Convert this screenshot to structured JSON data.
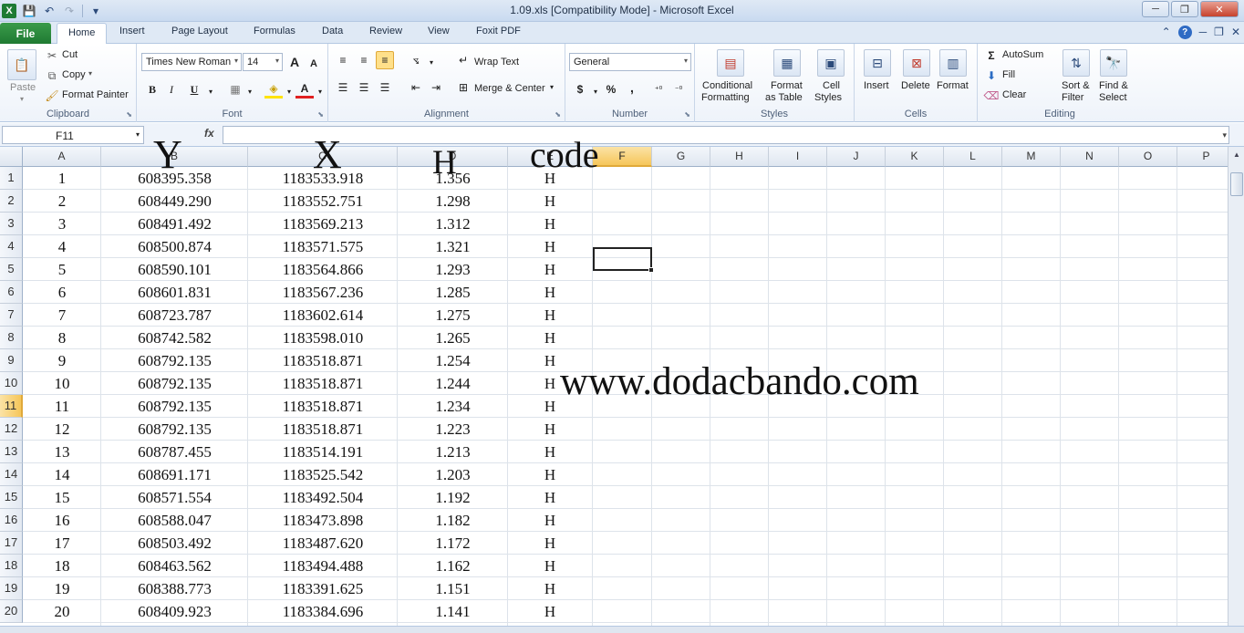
{
  "window": {
    "title": "1.09.xls  [Compatibility Mode]  -  Microsoft Excel",
    "logo": "X",
    "minimize": "─",
    "restore": "❐",
    "close": "✕"
  },
  "qat": {
    "save_icon": "💾",
    "undo_icon": "↶",
    "redo_icon": "↷",
    "customize_icon": "▾"
  },
  "tabs": {
    "file": "File",
    "items": [
      "Home",
      "Insert",
      "Page Layout",
      "Formulas",
      "Data",
      "Review",
      "View",
      "Foxit PDF"
    ],
    "active": "Home",
    "right_icons": [
      "⌃",
      "?",
      "─",
      "❐",
      "✕"
    ]
  },
  "ribbon": {
    "clipboard": {
      "label": "Clipboard",
      "paste": "Paste",
      "cut": "Cut",
      "copy": "Copy",
      "format_painter": "Format Painter"
    },
    "font": {
      "label": "Font",
      "font_name": "Times New Roman",
      "font_size": "14",
      "grow": "A",
      "shrink": "A",
      "bold": "B",
      "italic": "I",
      "underline": "U"
    },
    "alignment": {
      "label": "Alignment",
      "wrap_text": "Wrap Text",
      "merge_center": "Merge & Center"
    },
    "number": {
      "label": "Number",
      "format": "General",
      "currency": "$",
      "percent": "%",
      "comma": ","
    },
    "styles": {
      "label": "Styles",
      "conditional": [
        "Conditional",
        "Formatting"
      ],
      "format_table": [
        "Format",
        "as Table"
      ],
      "cell_styles": [
        "Cell",
        "Styles"
      ]
    },
    "cells": {
      "label": "Cells",
      "insert": "Insert",
      "delete": "Delete",
      "format": "Format"
    },
    "editing": {
      "label": "Editing",
      "autosum": "AutoSum",
      "fill": "Fill",
      "clear": "Clear",
      "sort_filter": [
        "Sort &",
        "Filter"
      ],
      "find_select": [
        "Find &",
        "Select"
      ]
    }
  },
  "formula_bar": {
    "name_box": "F11",
    "fx": "fx",
    "value": ""
  },
  "grid": {
    "columns": [
      "A",
      "B",
      "C",
      "D",
      "E",
      "F",
      "G",
      "H",
      "I",
      "J",
      "K",
      "L",
      "M",
      "N",
      "O",
      "P"
    ],
    "selected_column": "F",
    "selected_row": "11",
    "header_overlays": {
      "y": "Y",
      "x": "X",
      "h": "H",
      "code": "code"
    },
    "watermark": "www.dodacbando.com",
    "rows": [
      {
        "n": "1",
        "a": "1",
        "b": "608395.358",
        "c": "1183533.918",
        "d": "1.356",
        "e": "H"
      },
      {
        "n": "2",
        "a": "2",
        "b": "608449.290",
        "c": "1183552.751",
        "d": "1.298",
        "e": "H"
      },
      {
        "n": "3",
        "a": "3",
        "b": "608491.492",
        "c": "1183569.213",
        "d": "1.312",
        "e": "H"
      },
      {
        "n": "4",
        "a": "4",
        "b": "608500.874",
        "c": "1183571.575",
        "d": "1.321",
        "e": "H"
      },
      {
        "n": "5",
        "a": "5",
        "b": "608590.101",
        "c": "1183564.866",
        "d": "1.293",
        "e": "H"
      },
      {
        "n": "6",
        "a": "6",
        "b": "608601.831",
        "c": "1183567.236",
        "d": "1.285",
        "e": "H"
      },
      {
        "n": "7",
        "a": "7",
        "b": "608723.787",
        "c": "1183602.614",
        "d": "1.275",
        "e": "H"
      },
      {
        "n": "8",
        "a": "8",
        "b": "608742.582",
        "c": "1183598.010",
        "d": "1.265",
        "e": "H"
      },
      {
        "n": "9",
        "a": "9",
        "b": "608792.135",
        "c": "1183518.871",
        "d": "1.254",
        "e": "H"
      },
      {
        "n": "10",
        "a": "10",
        "b": "608792.135",
        "c": "1183518.871",
        "d": "1.244",
        "e": "H"
      },
      {
        "n": "11",
        "a": "11",
        "b": "608792.135",
        "c": "1183518.871",
        "d": "1.234",
        "e": "H"
      },
      {
        "n": "12",
        "a": "12",
        "b": "608792.135",
        "c": "1183518.871",
        "d": "1.223",
        "e": "H"
      },
      {
        "n": "13",
        "a": "13",
        "b": "608787.455",
        "c": "1183514.191",
        "d": "1.213",
        "e": "H"
      },
      {
        "n": "14",
        "a": "14",
        "b": "608691.171",
        "c": "1183525.542",
        "d": "1.203",
        "e": "H"
      },
      {
        "n": "15",
        "a": "15",
        "b": "608571.554",
        "c": "1183492.504",
        "d": "1.192",
        "e": "H"
      },
      {
        "n": "16",
        "a": "16",
        "b": "608588.047",
        "c": "1183473.898",
        "d": "1.182",
        "e": "H"
      },
      {
        "n": "17",
        "a": "17",
        "b": "608503.492",
        "c": "1183487.620",
        "d": "1.172",
        "e": "H"
      },
      {
        "n": "18",
        "a": "18",
        "b": "608463.562",
        "c": "1183494.488",
        "d": "1.162",
        "e": "H"
      },
      {
        "n": "19",
        "a": "19",
        "b": "608388.773",
        "c": "1183391.625",
        "d": "1.151",
        "e": "H"
      },
      {
        "n": "20",
        "a": "20",
        "b": "608409.923",
        "c": "1183384.696",
        "d": "1.141",
        "e": "H"
      }
    ]
  },
  "colors": {
    "excel_green": "#1e7b34",
    "selection_header": "#f6c65a"
  }
}
